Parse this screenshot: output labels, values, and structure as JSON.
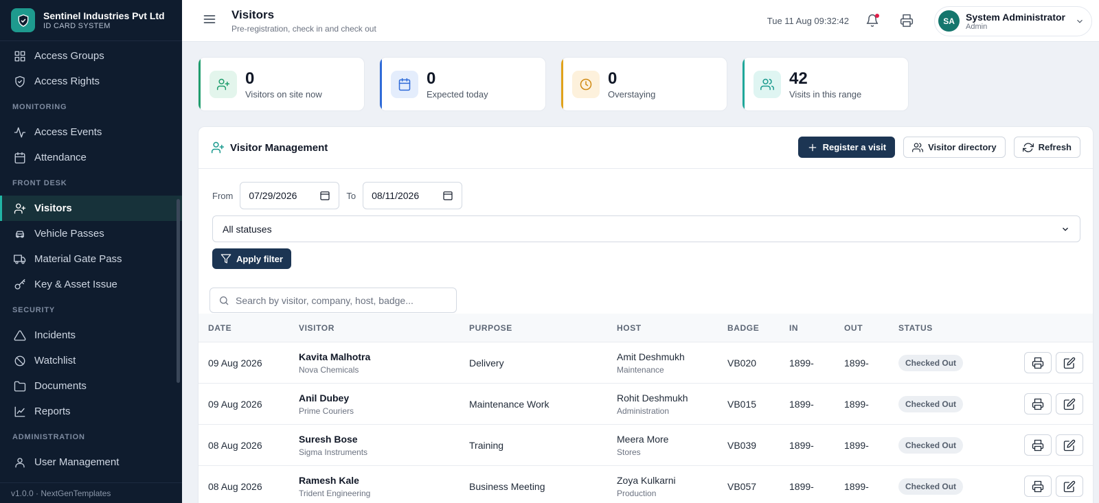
{
  "brand": {
    "name": "Sentinel Industries Pvt Ltd",
    "sub": "ID CARD SYSTEM"
  },
  "sidebar": {
    "items": [
      {
        "type": "item",
        "label": "Access Groups",
        "icon": "grid-icon"
      },
      {
        "type": "item",
        "label": "Access Rights",
        "icon": "shield-icon"
      },
      {
        "type": "section",
        "label": "MONITORING"
      },
      {
        "type": "item",
        "label": "Access Events",
        "icon": "activity-icon"
      },
      {
        "type": "item",
        "label": "Attendance",
        "icon": "calendar-icon"
      },
      {
        "type": "section",
        "label": "FRONT DESK"
      },
      {
        "type": "item",
        "label": "Visitors",
        "icon": "user-plus-icon",
        "active": true
      },
      {
        "type": "item",
        "label": "Vehicle Passes",
        "icon": "car-icon"
      },
      {
        "type": "item",
        "label": "Material Gate Pass",
        "icon": "truck-icon"
      },
      {
        "type": "item",
        "label": "Key & Asset Issue",
        "icon": "key-icon"
      },
      {
        "type": "section",
        "label": "SECURITY"
      },
      {
        "type": "item",
        "label": "Incidents",
        "icon": "alert-triangle-icon"
      },
      {
        "type": "item",
        "label": "Watchlist",
        "icon": "ban-icon"
      },
      {
        "type": "item",
        "label": "Documents",
        "icon": "folder-icon"
      },
      {
        "type": "item",
        "label": "Reports",
        "icon": "line-chart-icon"
      },
      {
        "type": "section",
        "label": "ADMINISTRATION"
      },
      {
        "type": "item",
        "label": "User Management",
        "icon": "user-icon"
      }
    ],
    "footer": "v1.0.0 · NextGenTemplates"
  },
  "header": {
    "title": "Visitors",
    "subtitle": "Pre-registration, check in and check out",
    "datetime": "Tue 11 Aug 09:32:42",
    "user": {
      "initials": "SA",
      "name": "System Administrator",
      "role": "Admin"
    }
  },
  "stats": [
    {
      "value": "0",
      "label": "Visitors on site now",
      "icon": "user-plus-icon"
    },
    {
      "value": "0",
      "label": "Expected today",
      "icon": "calendar-icon"
    },
    {
      "value": "0",
      "label": "Overstaying",
      "icon": "clock-icon"
    },
    {
      "value": "42",
      "label": "Visits in this range",
      "icon": "users-icon"
    }
  ],
  "panel": {
    "title": "Visitor Management",
    "buttons": {
      "register": "Register a visit",
      "directory": "Visitor directory",
      "refresh": "Refresh"
    },
    "filters": {
      "from_label": "From",
      "from_value": "07/29/2026",
      "to_label": "To",
      "to_value": "08/11/2026",
      "status": "All statuses",
      "apply": "Apply filter"
    },
    "search_placeholder": "Search by visitor, company, host, badge..."
  },
  "table": {
    "columns": {
      "date": "DATE",
      "visitor": "VISITOR",
      "purpose": "PURPOSE",
      "host": "HOST",
      "badge": "BADGE",
      "in": "IN",
      "out": "OUT",
      "status": "STATUS"
    },
    "rows": [
      {
        "date": "09 Aug 2026",
        "visitor": "Kavita Malhotra",
        "company": "Nova Chemicals",
        "purpose": "Delivery",
        "host": "Amit Deshmukh",
        "dept": "Maintenance",
        "badge": "VB020",
        "in": "1899-",
        "out": "1899-",
        "status": "Checked Out"
      },
      {
        "date": "09 Aug 2026",
        "visitor": "Anil Dubey",
        "company": "Prime Couriers",
        "purpose": "Maintenance Work",
        "host": "Rohit Deshmukh",
        "dept": "Administration",
        "badge": "VB015",
        "in": "1899-",
        "out": "1899-",
        "status": "Checked Out"
      },
      {
        "date": "08 Aug 2026",
        "visitor": "Suresh Bose",
        "company": "Sigma Instruments",
        "purpose": "Training",
        "host": "Meera More",
        "dept": "Stores",
        "badge": "VB039",
        "in": "1899-",
        "out": "1899-",
        "status": "Checked Out"
      },
      {
        "date": "08 Aug 2026",
        "visitor": "Ramesh Kale",
        "company": "Trident Engineering",
        "purpose": "Business Meeting",
        "host": "Zoya Kulkarni",
        "dept": "Production",
        "badge": "VB057",
        "in": "1899-",
        "out": "1899-",
        "status": "Checked Out"
      }
    ]
  },
  "colors": {
    "sidebar_bg": "#0f1c2e",
    "accent": "#1e9a8e",
    "primary_button": "#1c3553"
  }
}
